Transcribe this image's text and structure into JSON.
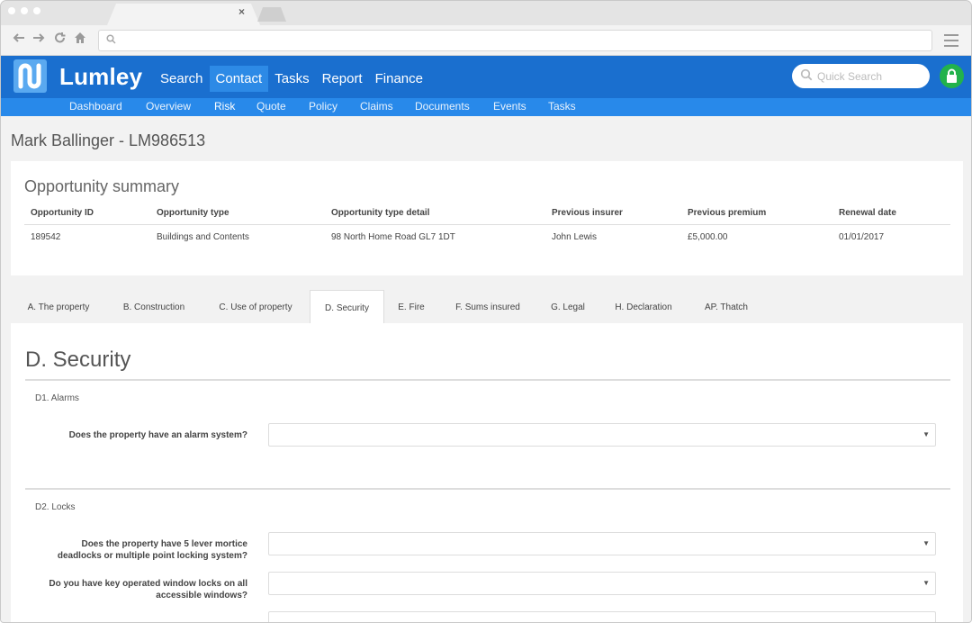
{
  "browser": {
    "tab_close": "×",
    "icons": {
      "back": "arrow-left-icon",
      "forward": "arrow-right-icon",
      "reload": "reload-icon",
      "home": "home-icon",
      "search": "search-icon",
      "menu": "hamburger-icon"
    },
    "address_value": ""
  },
  "app": {
    "brand": "Lumley",
    "colors": {
      "topbar": "#1a6fcf",
      "subnav": "#2889ea",
      "active_nav": "#2d8ae6",
      "lock": "#22b24c"
    },
    "main_nav": [
      {
        "label": "Search",
        "active": false
      },
      {
        "label": "Contact",
        "active": true
      },
      {
        "label": "Tasks",
        "active": false
      },
      {
        "label": "Report",
        "active": false
      },
      {
        "label": "Finance",
        "active": false
      }
    ],
    "quick_search_placeholder": "Quick Search",
    "sub_nav": [
      {
        "label": "Dashboard",
        "active": false
      },
      {
        "label": "Overview",
        "active": false
      },
      {
        "label": "Risk",
        "active": true
      },
      {
        "label": "Quote",
        "active": false
      },
      {
        "label": "Policy",
        "active": false
      },
      {
        "label": "Claims",
        "active": false
      },
      {
        "label": "Documents",
        "active": false
      },
      {
        "label": "Events",
        "active": false
      },
      {
        "label": "Tasks",
        "active": false
      }
    ]
  },
  "page": {
    "title": "Mark Ballinger - LM986513"
  },
  "summary": {
    "heading": "Opportunity summary",
    "columns": [
      "Opportunity ID",
      "Opportunity type",
      "Opportunity type detail",
      "Previous insurer",
      "Previous premium",
      "Renewal date"
    ],
    "row": [
      "189542",
      "Buildings and Contents",
      "98 North Home Road GL7 1DT",
      "John Lewis",
      "£5,000.00",
      "01/01/2017"
    ]
  },
  "tabs": [
    {
      "label": "A. The property",
      "active": false
    },
    {
      "label": "B. Construction",
      "active": false
    },
    {
      "label": "C. Use of property",
      "active": false
    },
    {
      "label": "D. Security",
      "active": true
    },
    {
      "label": "E. Fire",
      "active": false
    },
    {
      "label": "F. Sums insured",
      "active": false
    },
    {
      "label": "G. Legal",
      "active": false
    },
    {
      "label": "H. Declaration",
      "active": false
    },
    {
      "label": "AP. Thatch",
      "active": false
    }
  ],
  "security": {
    "heading": "D. Security",
    "alarms": {
      "label": "D1. Alarms",
      "q1": {
        "label": "Does the property have an alarm system?",
        "value": ""
      }
    },
    "locks": {
      "label": "D2. Locks",
      "q1": {
        "line1": "Does the property have 5 lever mortice",
        "line2": "deadlocks or multiple point locking system?",
        "value": ""
      },
      "q2": {
        "line1": "Do you have key operated window locks on all",
        "line2": "accessible windows?",
        "value": ""
      }
    }
  }
}
